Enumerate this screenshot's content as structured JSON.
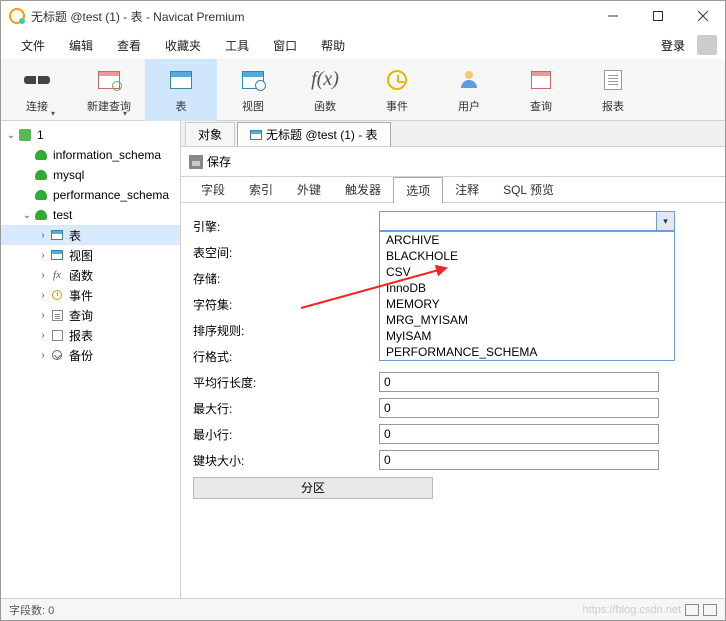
{
  "titlebar": {
    "title": "无标题 @test (1) - 表 - Navicat Premium"
  },
  "menubar": {
    "items": [
      "文件",
      "编辑",
      "查看",
      "收藏夹",
      "工具",
      "窗口",
      "帮助"
    ],
    "login": "登录"
  },
  "toolbar": {
    "items": [
      {
        "label": "连接",
        "icon": "plug"
      },
      {
        "label": "新建查询",
        "icon": "newq"
      },
      {
        "label": "表",
        "icon": "table",
        "active": true
      },
      {
        "label": "视图",
        "icon": "view"
      },
      {
        "label": "函数",
        "icon": "fx"
      },
      {
        "label": "事件",
        "icon": "event"
      },
      {
        "label": "用户",
        "icon": "user"
      },
      {
        "label": "查询",
        "icon": "query"
      },
      {
        "label": "报表",
        "icon": "report"
      }
    ]
  },
  "tree": {
    "items": [
      {
        "depth": 0,
        "caret": "down",
        "icon": "conn",
        "label": "1"
      },
      {
        "depth": 1,
        "caret": "none",
        "icon": "db",
        "label": "information_schema"
      },
      {
        "depth": 1,
        "caret": "none",
        "icon": "db",
        "label": "mysql"
      },
      {
        "depth": 1,
        "caret": "none",
        "icon": "db",
        "label": "performance_schema"
      },
      {
        "depth": 1,
        "caret": "down",
        "icon": "db",
        "label": "test"
      },
      {
        "depth": 2,
        "caret": "right",
        "icon": "table",
        "label": "表",
        "sel": true
      },
      {
        "depth": 2,
        "caret": "right",
        "icon": "view",
        "label": "视图"
      },
      {
        "depth": 2,
        "caret": "right",
        "icon": "fx",
        "label": "函数"
      },
      {
        "depth": 2,
        "caret": "right",
        "icon": "event",
        "label": "事件"
      },
      {
        "depth": 2,
        "caret": "right",
        "icon": "query",
        "label": "查询"
      },
      {
        "depth": 2,
        "caret": "right",
        "icon": "report",
        "label": "报表"
      },
      {
        "depth": 2,
        "caret": "right",
        "icon": "backup",
        "label": "备份"
      }
    ]
  },
  "doc_tabs": {
    "items": [
      {
        "label": "对象",
        "active": false
      },
      {
        "label": "无标题 @test (1) - 表",
        "active": true,
        "icon": "table"
      }
    ]
  },
  "save_label": "保存",
  "prop_tabs": {
    "items": [
      "字段",
      "索引",
      "外键",
      "触发器",
      "选项",
      "注释",
      "SQL 预览"
    ],
    "active_index": 4
  },
  "form": {
    "rows": [
      {
        "label": "引擎:",
        "kind": "combo"
      },
      {
        "label": "表空间:",
        "kind": "blank"
      },
      {
        "label": "存储:",
        "kind": "blank"
      },
      {
        "label": "字符集:",
        "kind": "blank"
      },
      {
        "label": "排序规则:",
        "kind": "blank"
      },
      {
        "label": "行格式:",
        "kind": "blank"
      },
      {
        "label": "平均行长度:",
        "kind": "input",
        "value": "0"
      },
      {
        "label": "最大行:",
        "kind": "input",
        "value": "0"
      },
      {
        "label": "最小行:",
        "kind": "input",
        "value": "0"
      },
      {
        "label": "键块大小:",
        "kind": "input",
        "value": "0"
      }
    ],
    "partition": "分区"
  },
  "engine_dropdown": {
    "options": [
      "ARCHIVE",
      "BLACKHOLE",
      "CSV",
      "InnoDB",
      "MEMORY",
      "MRG_MYISAM",
      "MyISAM",
      "PERFORMANCE_SCHEMA"
    ]
  },
  "statusbar": {
    "fields": "字段数: 0",
    "watermark": "https://blog.csdn.net"
  }
}
